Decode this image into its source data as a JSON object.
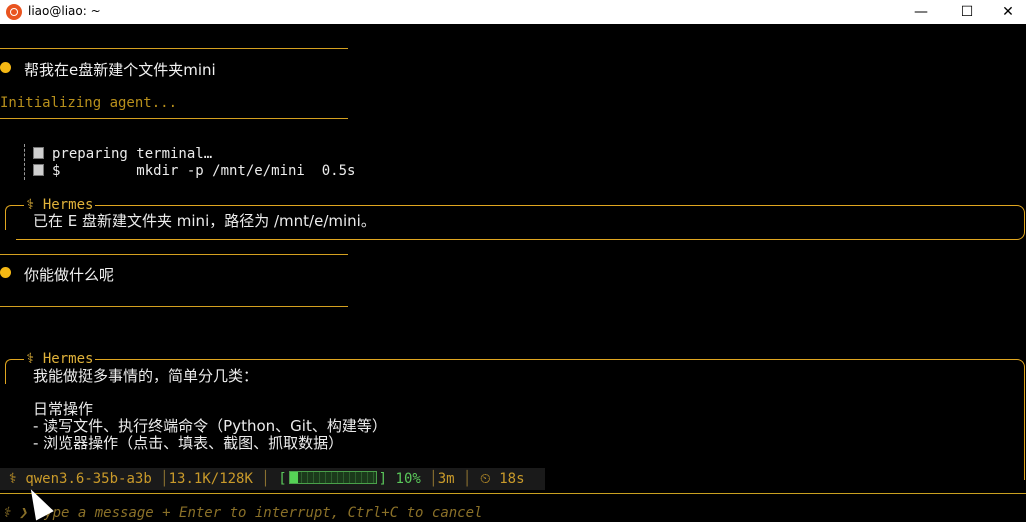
{
  "window": {
    "title": "liao@liao: ~",
    "min_glyph": "—",
    "max_glyph": "☐",
    "close_glyph": "✕"
  },
  "conversation": {
    "user_msg_1": "帮我在e盘新建个文件夹mini",
    "init_text": "Initializing agent...",
    "tool_line_1": "preparing terminal…",
    "tool_line_2": "$         mkdir -p /mnt/e/mini  0.5s",
    "reply_1_title": "⚕ Hermes",
    "reply_1_text": "已在 E 盘新建文件夹 mini，路径为 /mnt/e/mini。",
    "user_msg_2": "你能做什么呢",
    "reply_2_title": "⚕ Hermes",
    "reply_2_lines": [
      "我能做挺多事情的，简单分几类：",
      "",
      "日常操作",
      "- 读写文件、执行终端命令（Python、Git、构建等）",
      "- 浏览器操作（点击、填表、截图、抓取数据）"
    ]
  },
  "statusbar": {
    "icon": "⚕",
    "model": "qwen3.6-35b-a3b",
    "tokens": "13.1K/128K",
    "context_percent": 10,
    "context_label": "10%",
    "duration": "3m",
    "timer_icon": "⏲",
    "elapsed": "18s"
  },
  "input": {
    "prompt": "⚕ ❯",
    "placeholder": "type a message + Enter to interrupt, Ctrl+C to cancel"
  },
  "colors": {
    "accent": "#e0b23a",
    "bullet": "#f5b814",
    "progress": "#56d256"
  }
}
